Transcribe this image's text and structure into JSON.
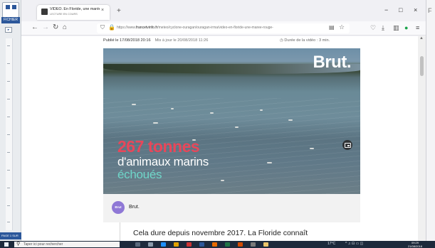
{
  "word_app": {
    "file_label": "FICHIER",
    "status": "PAGE 1 SUR"
  },
  "browser": {
    "tab": {
      "title": "VIDEO. En Floride, une marée",
      "subtitle": "LECTURE EN COURS",
      "close": "×"
    },
    "new_tab": "+",
    "window": {
      "minimize": "−",
      "maximize": "□",
      "close": "×"
    },
    "nav": {
      "back": "←",
      "forward": "→",
      "reload": "↻",
      "home": "⌂"
    },
    "url": {
      "prefix": "https://www.",
      "domain": "francetvinfo.fr",
      "path": "/meteo/cyclone-ouragan/ouragan-irma/video-en-floride-une-maree-rouge-"
    }
  },
  "article": {
    "published": "Publié le 17/08/2018 20:16",
    "updated": "Mis à jour le 20/08/2018 11:26",
    "duration": "◷ Durée de la vidéo : 3 min.",
    "video": {
      "logo": "Brut.",
      "caption_line1": "267 tonnes",
      "caption_line2": "d'animaux marins",
      "caption_line3": "échoués"
    },
    "source_avatar": "Brut",
    "source_name": "Brut.",
    "body_text": "Cela dure depuis novembre 2017. La Floride connaît"
  },
  "taskbar": {
    "search_placeholder": "Taper ici pour rechercher",
    "weather": "17°C",
    "time": "09:29",
    "date": "21/08/2018"
  },
  "colors": {
    "caption_red": "#e8475a",
    "caption_teal": "#6fd6c9",
    "word_blue": "#2b579a",
    "brut_purple": "#8f78d6"
  }
}
